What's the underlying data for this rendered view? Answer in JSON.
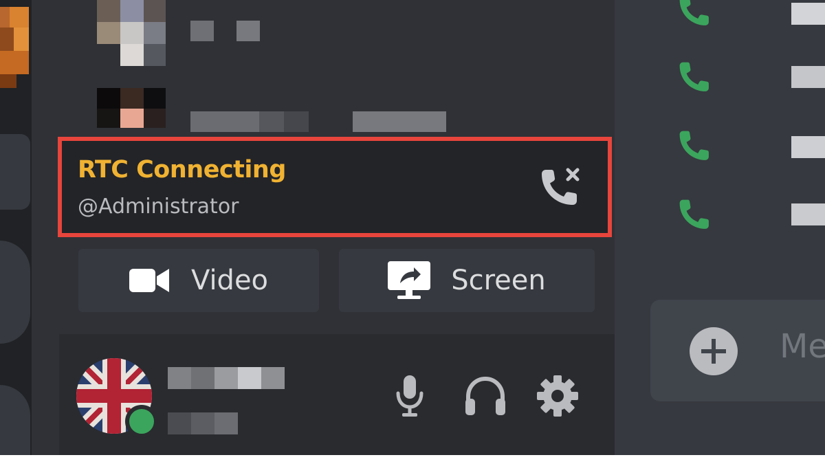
{
  "rtc_panel": {
    "status": "RTC Connecting",
    "channel": "@Administrator",
    "status_color": "#f0b232",
    "highlight_color": "#e8453c",
    "disconnect_icon": "phone-disconnect-icon"
  },
  "actions": {
    "video_label": "Video",
    "video_icon": "video-camera-icon",
    "screen_label": "Screen",
    "screen_icon": "screen-share-icon"
  },
  "user_panel": {
    "avatar_icon": "union-jack-avatar",
    "status": "online",
    "status_color": "#3ba55d",
    "mic_icon": "microphone-icon",
    "headset_icon": "headphones-icon",
    "settings_icon": "gear-icon"
  },
  "message_input": {
    "placeholder": "Me",
    "add_icon": "plus-circle-icon"
  },
  "colors": {
    "background": "#2f3136",
    "call_green": "#3ba55d"
  }
}
